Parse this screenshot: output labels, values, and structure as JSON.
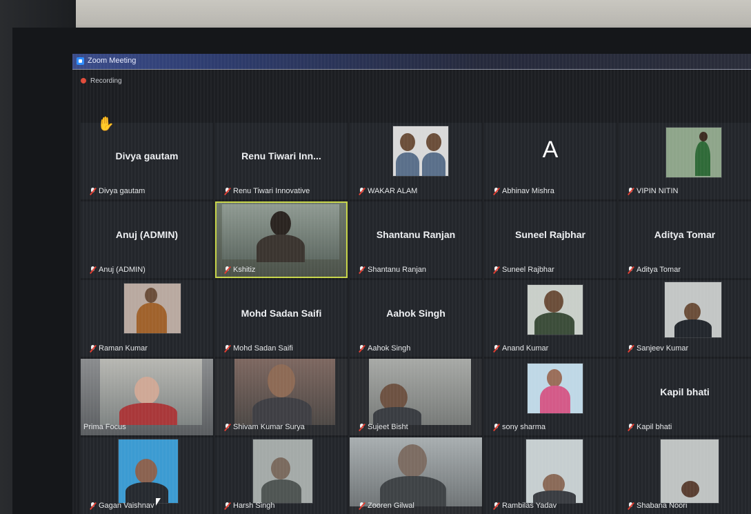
{
  "window": {
    "title": "Zoom Meeting"
  },
  "recording": {
    "label": "Recording"
  },
  "tiles": [
    {
      "center": "Divya gautam",
      "label": "Divya gautam"
    },
    {
      "center": "Renu Tiwari Inn...",
      "label": "Renu Tiwari Innovative"
    },
    {
      "center": "",
      "label": "WAKAR ALAM"
    },
    {
      "center": "",
      "label": "Abhinav Mishra",
      "avatar": "A"
    },
    {
      "center": "",
      "label": "VIPIN  NITIN"
    },
    {
      "center": "Anuj (ADMIN)",
      "label": "Anuj (ADMIN)"
    },
    {
      "center": "",
      "label": "Kshitiz"
    },
    {
      "center": "Shantanu Ranjan",
      "label": "Shantanu Ranjan"
    },
    {
      "center": "Suneel Rajbhar",
      "label": "Suneel Rajbhar"
    },
    {
      "center": "Aditya Tomar",
      "label": "Aditya Tomar"
    },
    {
      "center": "",
      "label": "Raman Kumar"
    },
    {
      "center": "Mohd Sadan Saifi",
      "label": "Mohd Sadan Saifi"
    },
    {
      "center": "Aahok Singh",
      "label": "Aahok Singh"
    },
    {
      "center": "",
      "label": "Anand Kumar"
    },
    {
      "center": "",
      "label": "Sanjeev Kumar"
    },
    {
      "center": "",
      "label": "Prima Focus"
    },
    {
      "center": "",
      "label": "Shivam Kumar Surya"
    },
    {
      "center": "",
      "label": "Sujeet Bisht"
    },
    {
      "center": "",
      "label": "sony sharma"
    },
    {
      "center": "Kapil bhati",
      "label": "Kapil bhati"
    },
    {
      "center": "",
      "label": "Gagan Vaishnav"
    },
    {
      "center": "",
      "label": "Harsh Singh"
    },
    {
      "center": "",
      "label": "Zooren Gilwal"
    },
    {
      "center": "",
      "label": "Rambilas Yadav"
    },
    {
      "center": "",
      "label": "Shabana Noori"
    }
  ]
}
